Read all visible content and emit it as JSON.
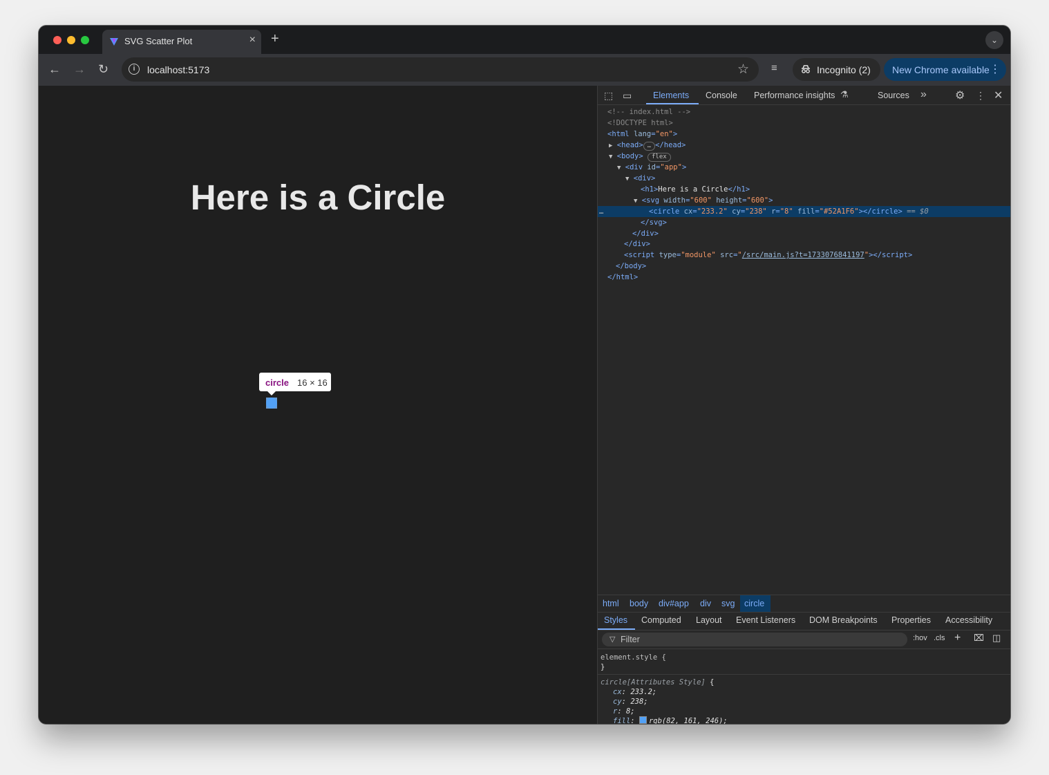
{
  "browser": {
    "tab_title": "SVG Scatter Plot",
    "new_tab": "+",
    "url": "localhost:5173",
    "incognito_label": "Incognito (2)",
    "update_label": "New Chrome available"
  },
  "page": {
    "heading": "Here is a Circle",
    "tooltip_tag": "circle",
    "tooltip_size": "16 × 16",
    "circle_fill": "#52A1F6"
  },
  "devtools": {
    "tabs": [
      "Elements",
      "Console",
      "Performance insights",
      "Sources"
    ],
    "dom": {
      "comment": "<!-- index.html -->",
      "doctype": "<!DOCTYPE html>",
      "html_lang": "\"en\"",
      "body_badge": "flex",
      "div_id": "\"app\"",
      "h1_text": "Here is a Circle",
      "svg_width": "\"600\"",
      "svg_height": "\"600\"",
      "circle_cx": "\"233.2\"",
      "circle_cy": "\"238\"",
      "circle_r": "\"8\"",
      "circle_fill": "\"#52A1F6\"",
      "selected_marker": "== $0",
      "script_type": "\"module\"",
      "script_src": "/src/main.js?t=1733076841197"
    },
    "breadcrumbs": [
      "html",
      "body",
      "div#app",
      "div",
      "svg",
      "circle"
    ],
    "style_tabs": [
      "Styles",
      "Computed",
      "Layout",
      "Event Listeners",
      "DOM Breakpoints",
      "Properties",
      "Accessibility"
    ],
    "filter_placeholder": "Filter",
    "hov": ":hov",
    "cls": ".cls",
    "rules": {
      "element_style": "element.style {",
      "close": "}",
      "attr_selector": "circle[Attributes Style]",
      "cx": "233.2;",
      "cy": "238;",
      "r": "8;",
      "fill": "rgb(82, 161, 246);"
    }
  }
}
